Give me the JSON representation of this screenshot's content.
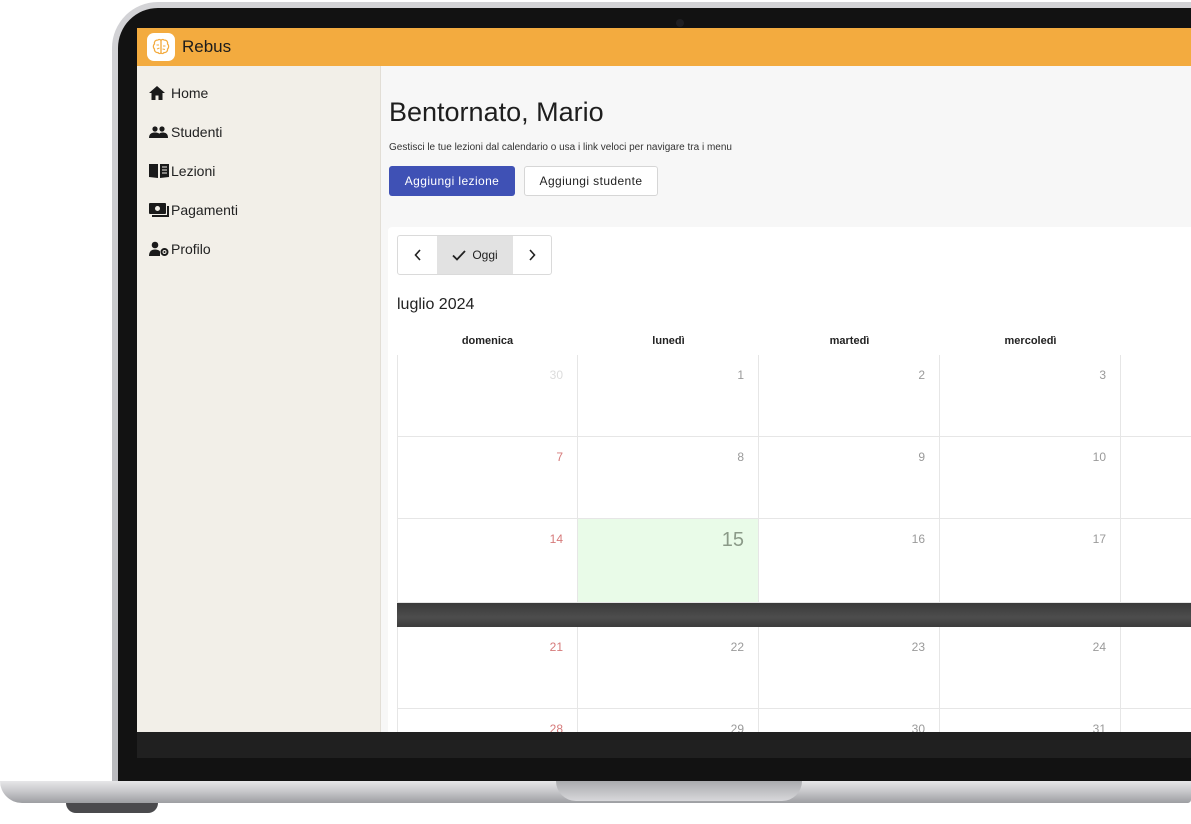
{
  "app": {
    "name": "Rebus",
    "logo_icon": "brain-icon",
    "accent": "#f3ab3f"
  },
  "sidebar": {
    "items": [
      {
        "label": "Home",
        "icon": "home-icon"
      },
      {
        "label": "Studenti",
        "icon": "users-icon"
      },
      {
        "label": "Lezioni",
        "icon": "book-icon"
      },
      {
        "label": "Pagamenti",
        "icon": "payment-icon"
      },
      {
        "label": "Profilo",
        "icon": "profile-settings-icon"
      }
    ]
  },
  "main": {
    "welcome": "Bentornato, Mario",
    "subtitle": "Gestisci le tue lezioni dal calendario o usa i link veloci per navigare tra i menu",
    "add_lesson_label": "Aggiungi lezione",
    "add_student_label": "Aggiungi studente",
    "primary_color": "#3f51b5"
  },
  "calendar": {
    "today_label": "Oggi",
    "month_label": "luglio 2024",
    "weekdays": [
      "domenica",
      "lunedì",
      "martedì",
      "mercoledì"
    ],
    "today_highlight": "#e9fbe8",
    "weeks": [
      [
        "30",
        "1",
        "2",
        "3"
      ],
      [
        "7",
        "8",
        "9",
        "10"
      ],
      [
        "14",
        "15",
        "16",
        "17"
      ],
      [
        "21",
        "22",
        "23",
        "24"
      ],
      [
        "28",
        "29",
        "30",
        "31"
      ]
    ]
  }
}
